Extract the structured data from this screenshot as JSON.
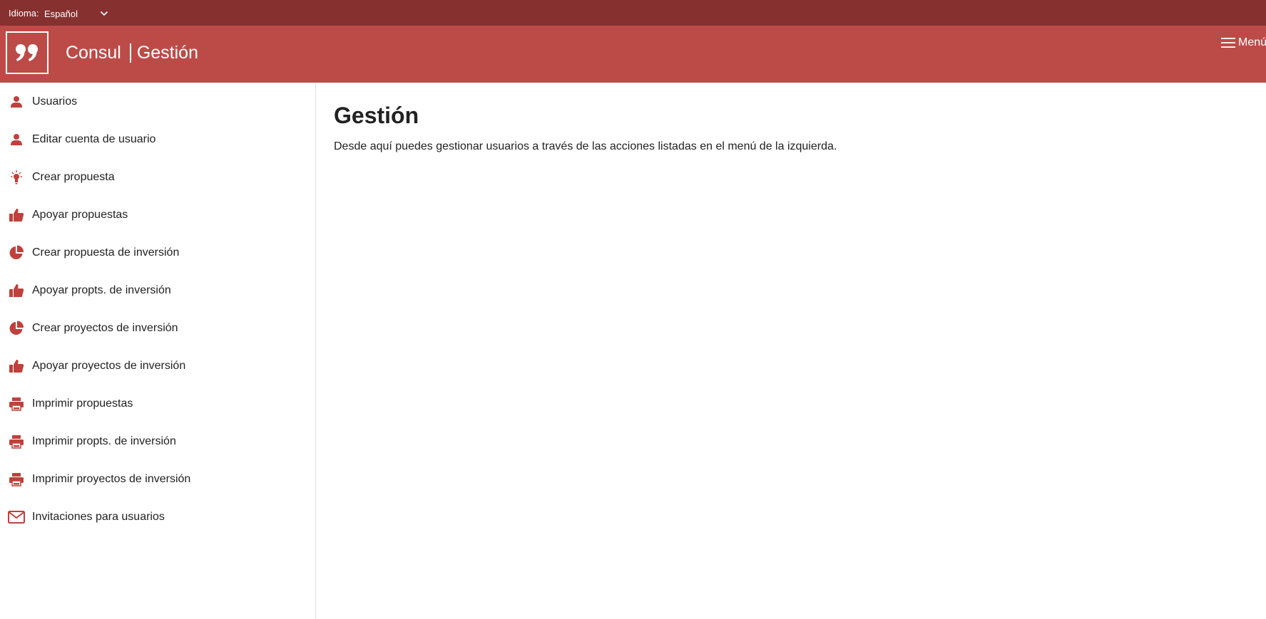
{
  "topbar": {
    "language_label": "Idioma:",
    "language_value": "Español"
  },
  "header": {
    "brand_name": "Consul",
    "section_name": "Gestión",
    "menu_label": "Menú"
  },
  "sidebar": {
    "items": [
      {
        "label": "Usuarios",
        "icon": "user-icon"
      },
      {
        "label": "Editar cuenta de usuario",
        "icon": "user-icon"
      },
      {
        "label": "Crear propuesta",
        "icon": "lightbulb-icon"
      },
      {
        "label": "Apoyar propuestas",
        "icon": "thumbs-up-icon"
      },
      {
        "label": "Crear propuesta de inversión",
        "icon": "pie-chart-icon"
      },
      {
        "label": "Apoyar propts. de inversión",
        "icon": "thumbs-up-icon"
      },
      {
        "label": "Crear proyectos de inversión",
        "icon": "pie-chart-icon"
      },
      {
        "label": "Apoyar proyectos de inversión",
        "icon": "thumbs-up-icon"
      },
      {
        "label": "Imprimir propuestas",
        "icon": "printer-icon"
      },
      {
        "label": "Imprimir propts. de inversión",
        "icon": "printer-icon"
      },
      {
        "label": "Imprimir proyectos de inversión",
        "icon": "printer-icon"
      },
      {
        "label": "Invitaciones para usuarios",
        "icon": "envelope-icon"
      }
    ]
  },
  "main": {
    "title": "Gestión",
    "description": "Desde aquí puedes gestionar usuarios a través de las acciones listadas en el menú de la izquierda."
  },
  "colors": {
    "topbar": "#863030",
    "header": "#bc4b48",
    "icon": "#c0403d"
  }
}
